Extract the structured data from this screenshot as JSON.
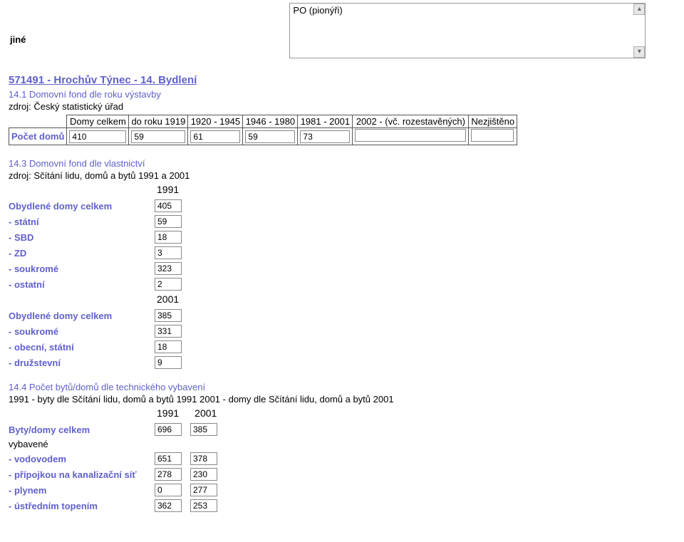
{
  "top": {
    "jine": "jiné",
    "po_text": "PO (pionýři)"
  },
  "page_title": "571491 - Hrochův Týnec - 14. Bydlení",
  "s141": {
    "title": "14.1 Domovní fond dle roku výstavby",
    "src": "zdroj: Český statistický úřad",
    "cols": {
      "c0": "Domy celkem",
      "c1": "do roku 1919",
      "c2": "1920 - 1945",
      "c3": "1946 - 1980",
      "c4": "1981 - 2001",
      "c5": "2002 - (vč. rozestavěných)",
      "c6": "Nezjištěno"
    },
    "row_label": "Počet domů",
    "vals": {
      "v0": "410",
      "v1": "59",
      "v2": "61",
      "v3": "59",
      "v4": "73",
      "v5": "",
      "v6": ""
    }
  },
  "s143": {
    "title": "14.3 Domovní fond dle vlastnictví",
    "src": "zdroj: Sčítání lidu, domů a bytů 1991 a 2001",
    "y1991": "1991",
    "y2001": "2001",
    "rows1": {
      "r0": {
        "label": "Obydlené domy celkem",
        "v": "405"
      },
      "r1": {
        "label": "- státní",
        "v": "59"
      },
      "r2": {
        "label": "- SBD",
        "v": "18"
      },
      "r3": {
        "label": "- ZD",
        "v": "3"
      },
      "r4": {
        "label": "- soukromé",
        "v": "323"
      },
      "r5": {
        "label": "- ostatní",
        "v": "2"
      }
    },
    "rows2": {
      "r0": {
        "label": "Obydlené domy celkem",
        "v": "385"
      },
      "r1": {
        "label": "- soukromé",
        "v": "331"
      },
      "r2": {
        "label": "- obecní, státní",
        "v": "18"
      },
      "r3": {
        "label": "- družstevní",
        "v": "9"
      }
    }
  },
  "s144": {
    "title": "14.4 Počet bytů/domů dle technického vybavení",
    "src": "1991 - byty dle Sčítání lidu, domů a bytů 1991 2001 - domy dle Sčítání lidu, domů a bytů 2001",
    "y1991": "1991",
    "y2001": "2001",
    "rows": {
      "r0": {
        "label": "Byty/domy celkem",
        "v1": "696",
        "v2": "385"
      },
      "sub": {
        "label": "vybavené"
      },
      "r1": {
        "label": "- vodovodem",
        "v1": "651",
        "v2": "378"
      },
      "r2": {
        "label": "- přípojkou na kanalizační síť",
        "v1": "278",
        "v2": "230"
      },
      "r3": {
        "label": "- plynem",
        "v1": "0",
        "v2": "277"
      },
      "r4": {
        "label": "- ústředním topením",
        "v1": "362",
        "v2": "253"
      }
    }
  }
}
